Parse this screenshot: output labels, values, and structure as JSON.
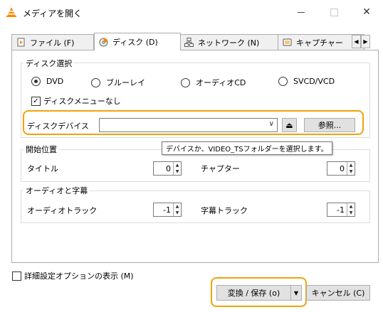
{
  "window": {
    "title": "メディアを開く",
    "minimize_glyph": "—",
    "close_glyph": "✕"
  },
  "tabs": [
    {
      "label": "ファイル (F)",
      "icon": "file-icon"
    },
    {
      "label": "ディスク (D)",
      "icon": "disc-icon"
    },
    {
      "label": "ネットワーク (N)",
      "icon": "network-icon"
    },
    {
      "label": "キャプチャー",
      "icon": "capture-icon"
    }
  ],
  "disc": {
    "group_title": "ディスク選択",
    "options": [
      "DVD",
      "ブルーレイ",
      "オーディオCD",
      "SVCD/VCD"
    ],
    "selected": "DVD",
    "menu_checkbox": {
      "label": "ディスクメニューなし",
      "checked": true
    },
    "device_label": "ディスクデバイス",
    "device_value": "",
    "eject_glyph": "⏏",
    "browse_label": "参照..."
  },
  "tooltip": "デバイスか、VIDEO_TSフォルダーを選択します。",
  "start": {
    "group_title": "開始位置",
    "title_label": "タイトル",
    "title_value": "0",
    "chapter_label": "チャプター",
    "chapter_value": "0"
  },
  "audio_sub": {
    "group_title": "オーディオと字幕",
    "audio_label": "オーディオトラック",
    "audio_value": "-1",
    "sub_label": "字幕トラック",
    "sub_value": "-1"
  },
  "footer": {
    "advanced_checkbox": {
      "label": "詳細設定オプションの表示 (M)",
      "checked": false
    },
    "convert_label": "変換 / 保存 (o)",
    "cancel_label": "キャンセル (C)"
  },
  "colors": {
    "highlight": "#f0a30a",
    "vlc_orange": "#ff8800"
  }
}
